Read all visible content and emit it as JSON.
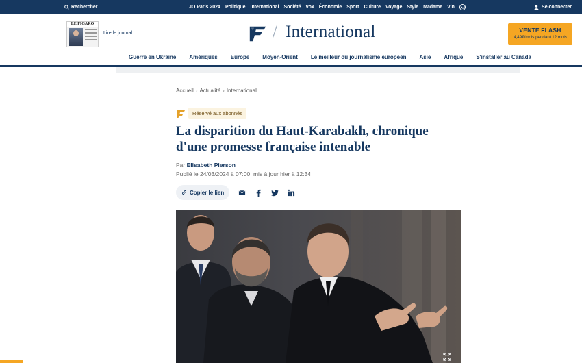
{
  "topbar": {
    "search_label": "Rechercher",
    "nav": [
      "JO Paris 2024",
      "Politique",
      "International",
      "Société",
      "Vox",
      "Économie",
      "Sport",
      "Culture",
      "Voyage",
      "Style",
      "Madame",
      "Vin"
    ],
    "login_label": "Se connecter",
    "background_color": "#163860"
  },
  "header": {
    "paper_masthead": "LE FIGARO",
    "read_paper_label": "Lire le journal",
    "section_title": "International",
    "flash": {
      "title": "VENTE FLASH",
      "subtitle": "4,49€/mois pendant 12 mois",
      "color": "#f5a623"
    }
  },
  "section_nav": [
    "Guerre en Ukraine",
    "Amériques",
    "Europe",
    "Moyen-Orient",
    "Le meilleur du journalisme européen",
    "Asie",
    "Afrique",
    "S'installer au Canada"
  ],
  "article": {
    "breadcrumb": [
      "Accueil",
      "Actualité",
      "International"
    ],
    "badge": "Réservé aux abonnés",
    "headline": "La disparition du Haut-Karabakh, chronique d'une promesse française intenable",
    "by_prefix": "Par",
    "author": "Elisabeth Pierson",
    "published": "Publié le 24/03/2024 à 07:00, mis à jour hier à 12:34",
    "copy_link_label": "Copier le lien",
    "share_icons": [
      "mail-icon",
      "facebook-icon",
      "twitter-icon",
      "linkedin-icon"
    ]
  },
  "colors": {
    "brand_navy": "#163860",
    "accent_orange": "#f5a623",
    "badge_bg": "#fbf3e0"
  }
}
